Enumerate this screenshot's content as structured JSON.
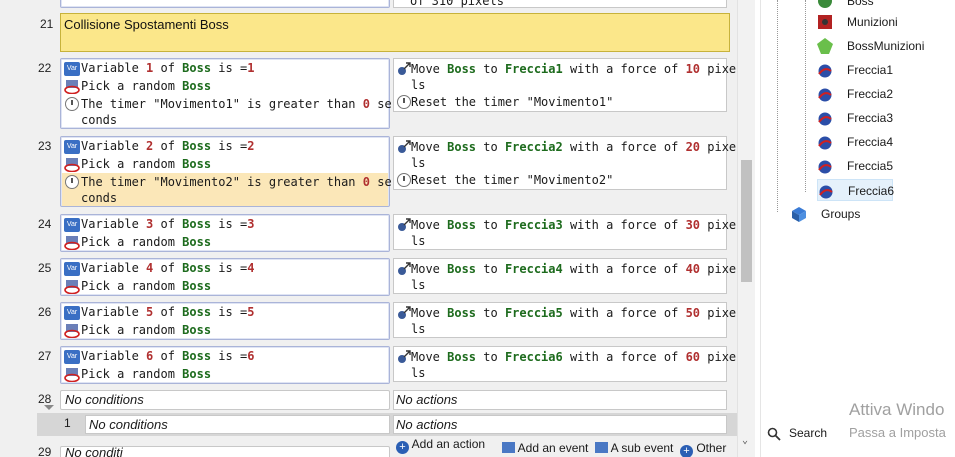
{
  "editor": {
    "prev_fragment": "of 310 pixels",
    "group_title": "Collisione Spostamenti Boss",
    "group_number": "21",
    "events": [
      {
        "num": "22",
        "cond_line1": {
          "pre": "Variable ",
          "n": "1",
          "mid": " of ",
          "obj": "Boss",
          "post": " is =",
          "v": "1"
        },
        "cond_line2": {
          "pre": "Pick a random ",
          "obj": "Boss"
        },
        "cond_line3a": "The timer \"Movimento1\" is greater than ",
        "cond_line3n": "0",
        "cond_line3b": " se",
        "cond_line3c": "conds",
        "act_a": "Move ",
        "act_obj": "Boss",
        "act_to": " to ",
        "act_target": "Freccia1",
        "act_force": " with a force of ",
        "act_val": "10",
        "act_px": " pixe",
        "act_px2": "ls",
        "act2": "Reset the timer \"Movimento1\""
      },
      {
        "num": "23",
        "cond_line1": {
          "pre": "Variable ",
          "n": "2",
          "mid": " of ",
          "obj": "Boss",
          "post": " is =",
          "v": "2"
        },
        "cond_line2": {
          "pre": "Pick a random ",
          "obj": "Boss"
        },
        "cond_line3a": "The timer \"Movimento2\" is greater than ",
        "cond_line3n": "0",
        "cond_line3b": " se",
        "cond_line3c": "conds",
        "act_a": "Move ",
        "act_obj": "Boss",
        "act_to": " to ",
        "act_target": "Freccia2",
        "act_force": " with a force of ",
        "act_val": "20",
        "act_px": " pixe",
        "act_px2": "ls",
        "act2": "Reset the timer \"Movimento2\""
      },
      {
        "num": "24",
        "cond_line1": {
          "pre": "Variable ",
          "n": "3",
          "mid": " of ",
          "obj": "Boss",
          "post": " is =",
          "v": "3"
        },
        "cond_line2": {
          "pre": "Pick a random ",
          "obj": "Boss"
        },
        "act_a": "Move ",
        "act_obj": "Boss",
        "act_to": " to ",
        "act_target": "Freccia3",
        "act_force": " with a force of ",
        "act_val": "30",
        "act_px": " pixe",
        "act_px2": "ls"
      },
      {
        "num": "25",
        "cond_line1": {
          "pre": "Variable ",
          "n": "4",
          "mid": " of ",
          "obj": "Boss",
          "post": " is =",
          "v": "4"
        },
        "cond_line2": {
          "pre": "Pick a random ",
          "obj": "Boss"
        },
        "act_a": "Move ",
        "act_obj": "Boss",
        "act_to": " to ",
        "act_target": "Freccia4",
        "act_force": " with a force of ",
        "act_val": "40",
        "act_px": " pixe",
        "act_px2": "ls"
      },
      {
        "num": "26",
        "cond_line1": {
          "pre": "Variable ",
          "n": "5",
          "mid": " of ",
          "obj": "Boss",
          "post": " is =",
          "v": "5"
        },
        "cond_line2": {
          "pre": "Pick a random ",
          "obj": "Boss"
        },
        "act_a": "Move ",
        "act_obj": "Boss",
        "act_to": " to ",
        "act_target": "Freccia5",
        "act_force": " with a force of ",
        "act_val": "50",
        "act_px": " pixe",
        "act_px2": "ls"
      },
      {
        "num": "27",
        "cond_line1": {
          "pre": "Variable ",
          "n": "6",
          "mid": " of ",
          "obj": "Boss",
          "post": " is =",
          "v": "6"
        },
        "cond_line2": {
          "pre": "Pick a random ",
          "obj": "Boss"
        },
        "act_a": "Move ",
        "act_obj": "Boss",
        "act_to": " to ",
        "act_target": "Freccia6",
        "act_force": " with a force of ",
        "act_val": "60",
        "act_px": " pixe",
        "act_px2": "ls"
      }
    ],
    "event28": {
      "num": "28",
      "no_conditions": "No conditions",
      "no_actions": "No actions"
    },
    "sub_event": {
      "num": "1",
      "no_conditions": "No conditions",
      "no_actions": "No actions"
    },
    "next_num": "29",
    "next_fragment": "No conditi",
    "tools": {
      "add_action": "Add an action",
      "add_event": "Add an event",
      "sub_event": "A sub event",
      "other": "Other"
    }
  },
  "tree": {
    "items": [
      {
        "label": "Boss",
        "icon": "boss-icon",
        "color": "#3a8a3a"
      },
      {
        "label": "Munizioni",
        "icon": "ammo-icon",
        "color": "#b22222"
      },
      {
        "label": "BossMunizioni",
        "icon": "boss-ammo-icon",
        "color": "#6abf4b"
      },
      {
        "label": "Freccia1",
        "icon": "arrow-sprite-icon",
        "color": "#2b4ea8"
      },
      {
        "label": "Freccia2",
        "icon": "arrow-sprite-icon",
        "color": "#2b4ea8"
      },
      {
        "label": "Freccia3",
        "icon": "arrow-sprite-icon",
        "color": "#2b4ea8"
      },
      {
        "label": "Freccia4",
        "icon": "arrow-sprite-icon",
        "color": "#2b4ea8"
      },
      {
        "label": "Freccia5",
        "icon": "arrow-sprite-icon",
        "color": "#2b4ea8"
      },
      {
        "label": "Freccia6",
        "icon": "arrow-sprite-icon",
        "color": "#2b4ea8"
      }
    ],
    "groups_label": "Groups",
    "watermark_title": "Attiva Windo",
    "watermark_sub": "Passa a Imposta",
    "search_label": "Search"
  }
}
